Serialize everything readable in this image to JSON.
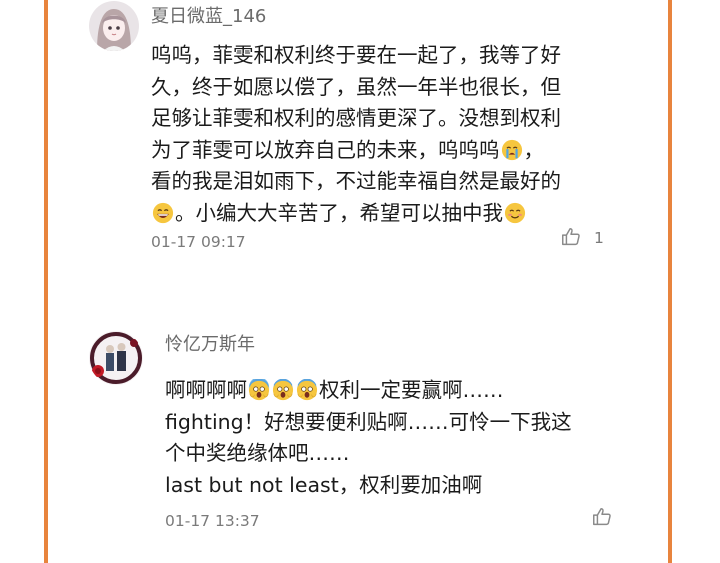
{
  "comments": [
    {
      "user": "夏日微蓝_146",
      "lines": [
        "呜呜，菲雯和权利终于要在一起了，我等了好",
        "久，终于如愿以偿了，虽然一年半也很长，但",
        "足够让菲雯和权利的感情更深了。没想到权利",
        "为了菲雯可以放弃自己的未来，呜呜呜",
        "看的我是泪如雨下，不过能幸福自然是最好的",
        "。小编大大辛苦了，希望可以抽中我"
      ],
      "time": "01-17 09:17",
      "likes": "1",
      "emoji": [
        "crying-face",
        "grinning-face",
        "smiling-face"
      ]
    },
    {
      "user": "怜亿万斯年",
      "lines": [
        "啊啊啊啊",
        "权利一定要赢啊……",
        "fighting！好想要便利贴啊……可怜一下我这",
        "个中奖绝缘体吧……",
        "last but not least，权利要加油啊"
      ],
      "time": "01-17 13:37",
      "emoji": [
        "screaming-face",
        "screaming-face",
        "screaming-face"
      ]
    }
  ],
  "colors": {
    "rail": "#e8843d",
    "meta": "#7a7a7a",
    "username": "#6b6b6b"
  },
  "icons": {
    "like": "thumbs-up-icon"
  }
}
